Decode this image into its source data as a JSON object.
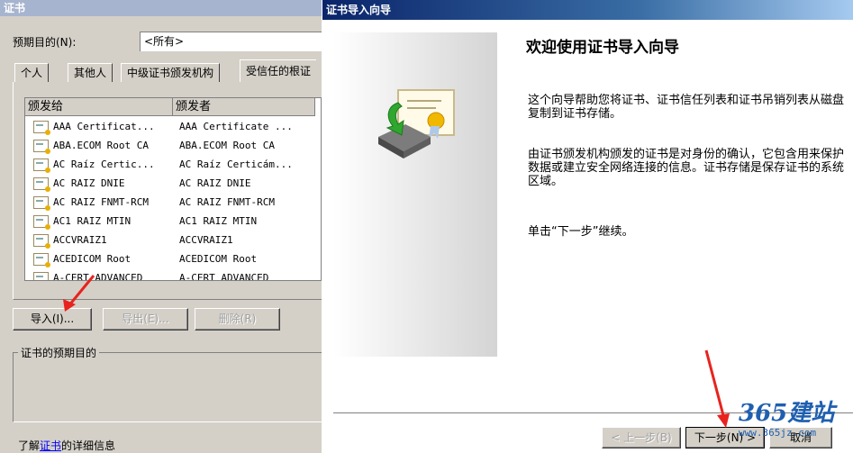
{
  "left_dialog": {
    "title": "证书",
    "purpose_label": "预期目的(N):",
    "purpose_value": "<所有>",
    "tabs": [
      "个人",
      "其他人",
      "中级证书颁发机构",
      "受信任的根证"
    ],
    "columns": [
      "颁发给",
      "颁发者"
    ],
    "rows": [
      {
        "issued_to": "AAA Certificat...",
        "issued_by": "AAA Certificate ..."
      },
      {
        "issued_to": "ABA.ECOM Root CA",
        "issued_by": "ABA.ECOM Root CA"
      },
      {
        "issued_to": "AC Raíz Certic...",
        "issued_by": "AC Raíz Certicám..."
      },
      {
        "issued_to": "AC RAIZ DNIE",
        "issued_by": "AC RAIZ DNIE"
      },
      {
        "issued_to": "AC RAIZ FNMT-RCM",
        "issued_by": "AC RAIZ FNMT-RCM"
      },
      {
        "issued_to": "AC1 RAIZ MTIN",
        "issued_by": "AC1 RAIZ MTIN"
      },
      {
        "issued_to": "ACCVRAIZ1",
        "issued_by": "ACCVRAIZ1"
      },
      {
        "issued_to": "ACEDICOM Root",
        "issued_by": "ACEDICOM Root"
      },
      {
        "issued_to": "A-CERT ADVANCED",
        "issued_by": "A-CERT ADVANCED"
      }
    ],
    "buttons": {
      "import": "导入(I)...",
      "export": "导出(E)...",
      "remove": "删除(R)"
    },
    "purpose_group_label": "证书的预期目的",
    "details_prefix": "了解",
    "details_link": "证书",
    "details_suffix": "的详细信息"
  },
  "wizard": {
    "title": "证书导入向导",
    "heading": "欢迎使用证书导入向导",
    "para1": "这个向导帮助您将证书、证书信任列表和证书吊销列表从磁盘复制到证书存储。",
    "para2": "由证书颁发机构颁发的证书是对身份的确认，它包含用来保护数据或建立安全网络连接的信息。证书存储是保存证书的系统区域。",
    "para3": "单击“下一步”继续。",
    "back_button": "< 上一步(B)",
    "next_button": "下一步(N) >",
    "cancel_button": "取消"
  },
  "watermark": {
    "brand": "365建站",
    "url": "www.365jz.com"
  },
  "colors": {
    "arrow": "#e8231e",
    "title_active": "#0a246a"
  }
}
